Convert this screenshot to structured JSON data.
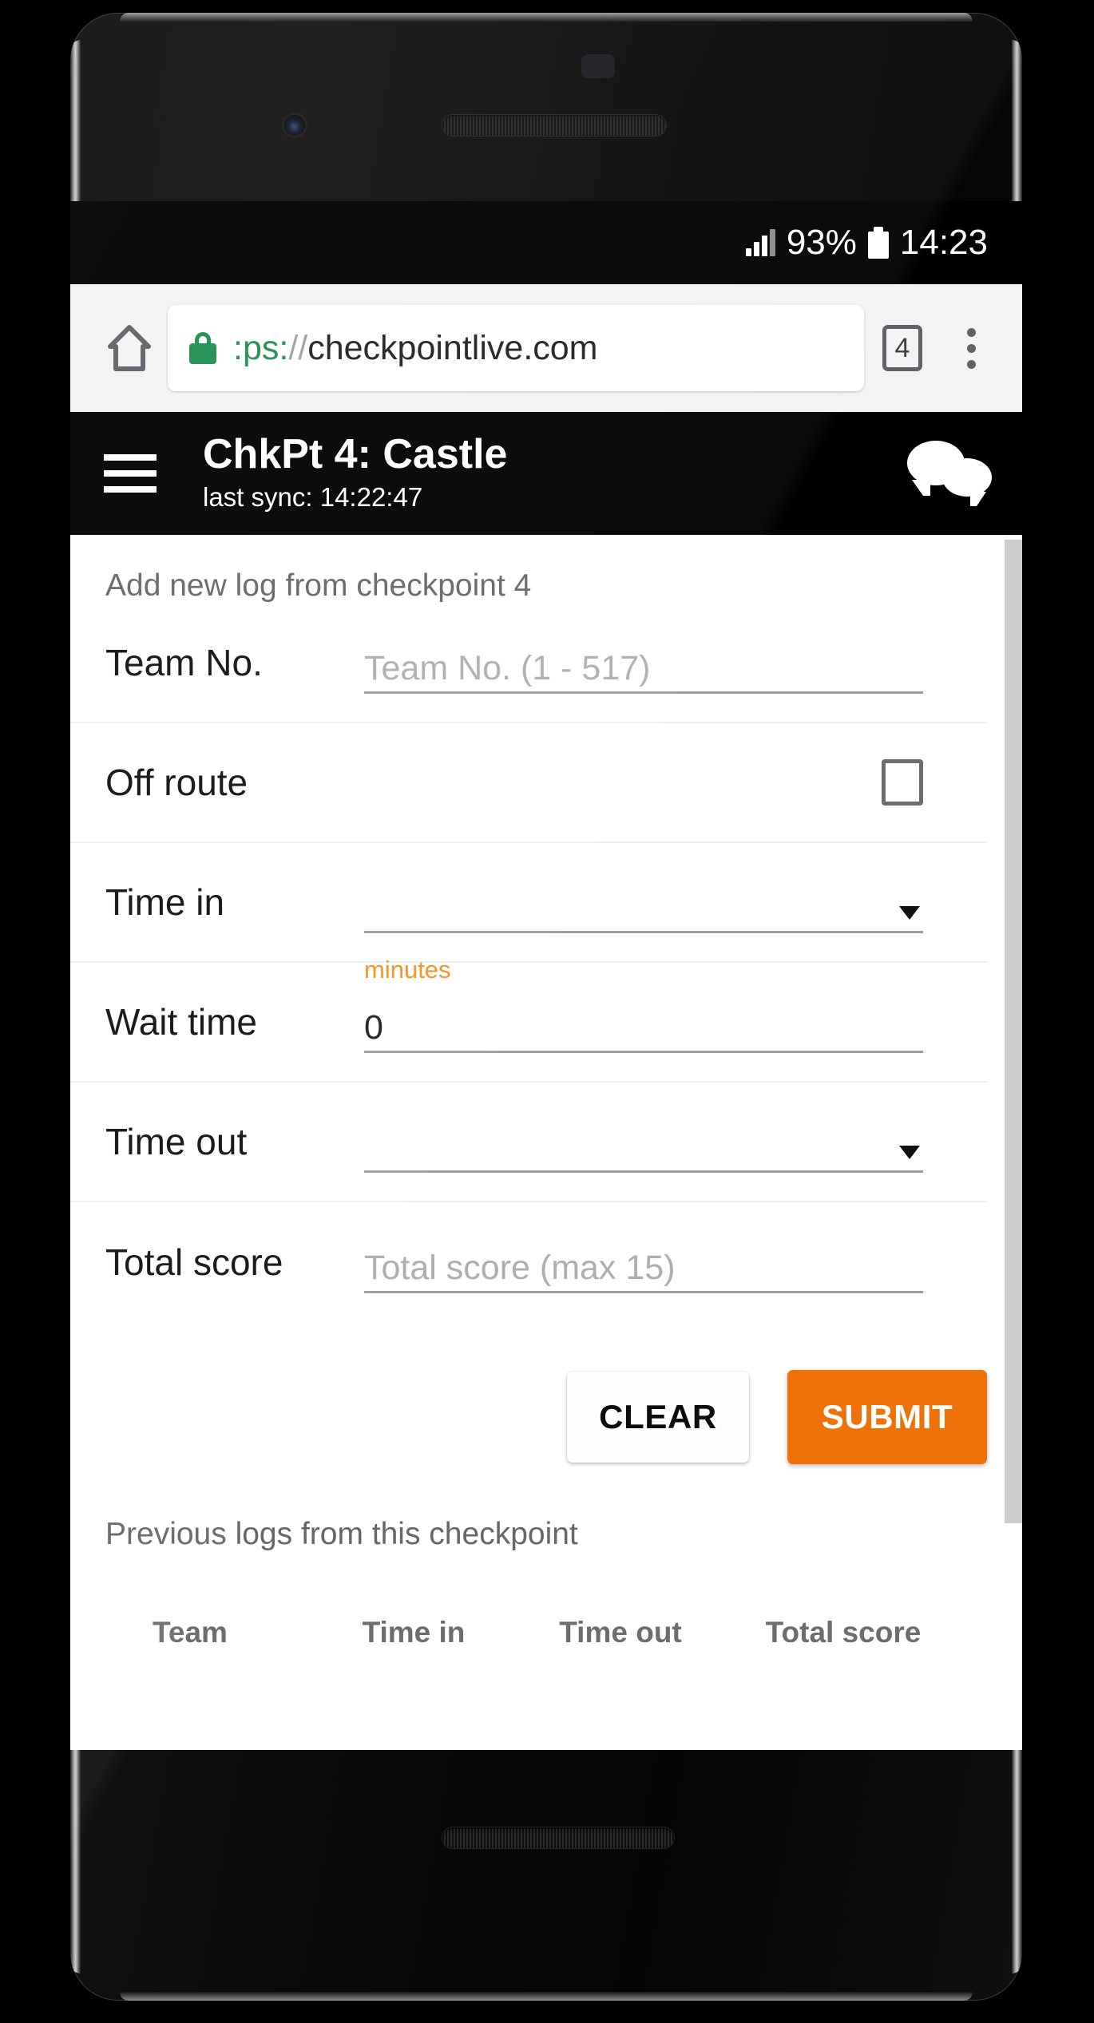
{
  "status_bar": {
    "signal_icon": "signal-bars-icon",
    "battery_percent": "93%",
    "battery_icon": "battery-full-icon",
    "clock": "14:23"
  },
  "browser": {
    "home_icon": "home-icon",
    "lock_icon": "lock-secure-icon",
    "url_scheme": ":ps:",
    "url_slashes": "//",
    "url_host": "checkpointlive.com",
    "url_full": ":ps://checkpointlive.com",
    "tab_count": "4",
    "overflow_icon": "overflow-menu-icon"
  },
  "app_bar": {
    "menu_icon": "hamburger-menu-icon",
    "title": "ChkPt 4: Castle",
    "subtitle": "last sync: 14:22:47",
    "chat_icon": "chat-bubbles-icon"
  },
  "form": {
    "heading": "Add new log from checkpoint 4",
    "rows": [
      {
        "label": "Team No.",
        "placeholder": "Team No. (1 - 517)",
        "value": "",
        "type": "text"
      },
      {
        "label": "Off route",
        "value": "",
        "checked": false,
        "type": "checkbox"
      },
      {
        "label": "Time in",
        "placeholder": "",
        "value": "",
        "type": "select"
      },
      {
        "label": "Wait time",
        "float_label": "minutes",
        "placeholder": "",
        "value": "0",
        "type": "text"
      },
      {
        "label": "Time out",
        "placeholder": "",
        "value": "",
        "type": "select"
      },
      {
        "label": "Total score",
        "placeholder": "Total score (max 15)",
        "value": "",
        "type": "text"
      }
    ],
    "clear_label": "CLEAR",
    "submit_label": "SUBMIT"
  },
  "previous_logs": {
    "heading": "Previous logs from this checkpoint",
    "columns": [
      "Team",
      "Time in",
      "Time out",
      "Total score"
    ],
    "rows": []
  },
  "colors": {
    "accent_orange": "#ee7209",
    "float_label_orange": "#f6901e",
    "lock_green": "#1e8e4e",
    "app_bar_black": "#000000",
    "browser_chrome": "#f1f3f4"
  }
}
